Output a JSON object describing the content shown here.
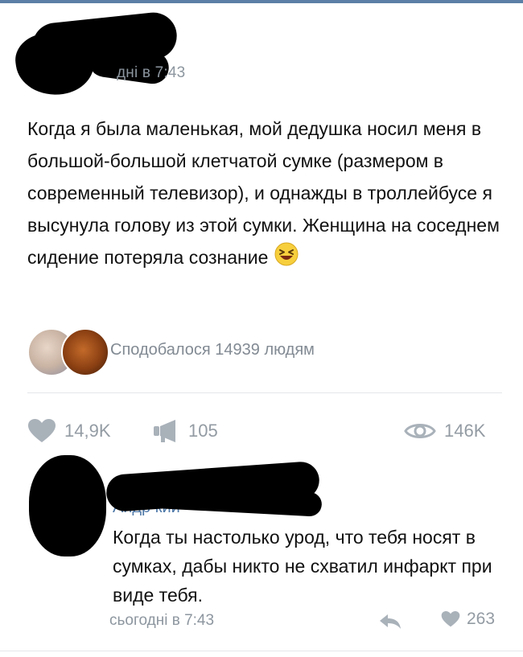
{
  "post": {
    "time": "дні в 7:43",
    "text": "Когда я была маленькая, мой дедушка носил меня в большой-большой клетчатой сумке (размером в современный телевизор), и однажды в троллейбусе я высунула голову из этой сумки. Женщина на соседнем сидение потеряла сознание",
    "emoji": "laughing-face-emoji",
    "liked_text": "Сподобалося 14939 людям",
    "likes_count": "14,9K",
    "shares_count": "105",
    "views_count": "146K"
  },
  "comment": {
    "author_residue": "Андр                        кий",
    "text": "Когда ты настолько урод, что тебя носят в сумках, дабы никто не схватил инфаркт при виде тебя.",
    "time": "сьогодні в 7:43",
    "likes_count": "263"
  },
  "colors": {
    "accent": "#5b7fa6",
    "muted_text": "#8d969f",
    "icon": "#a9b1b9"
  }
}
